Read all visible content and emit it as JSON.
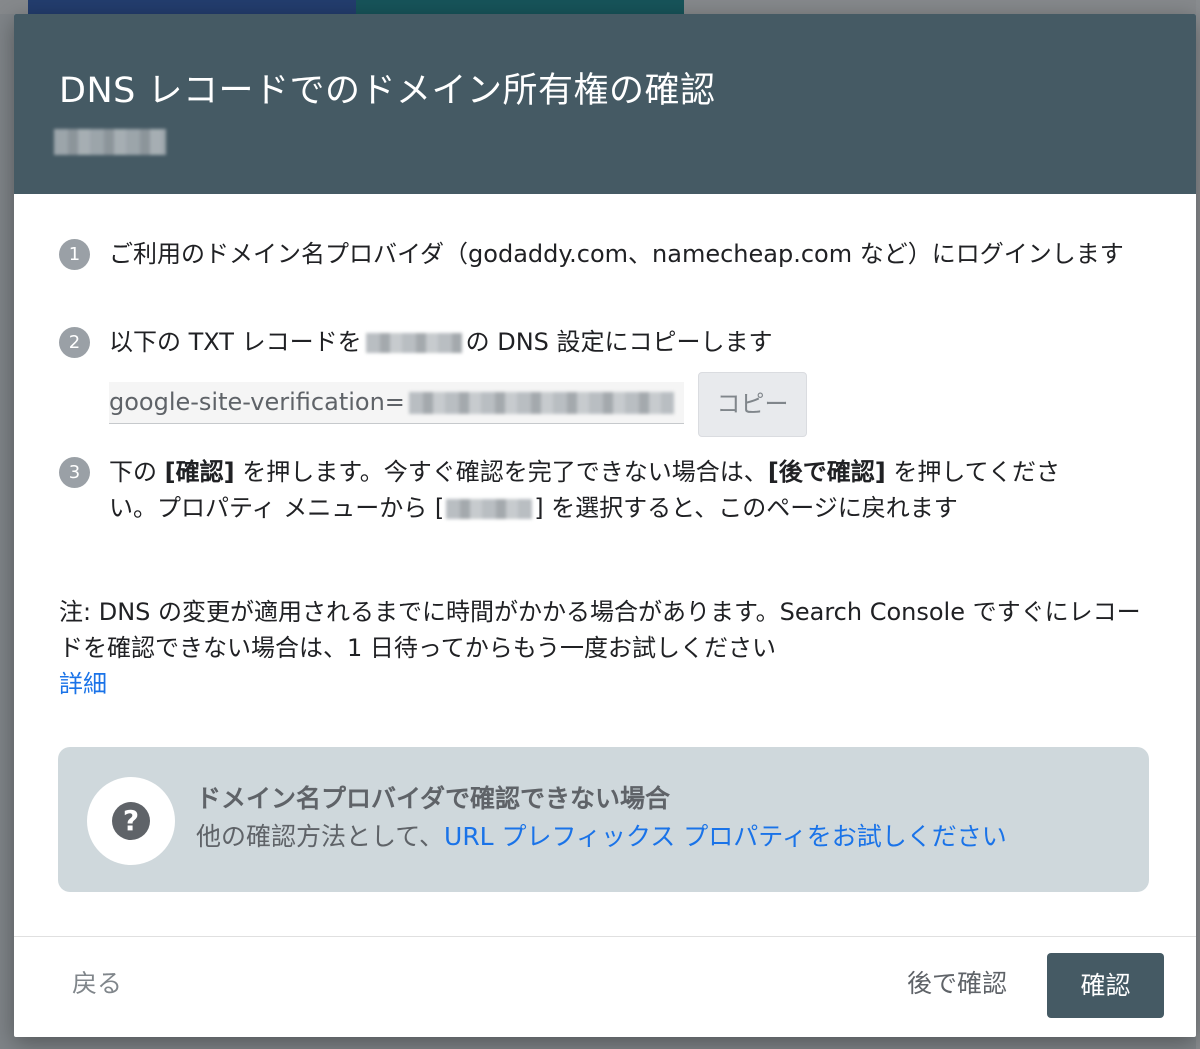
{
  "dialog": {
    "title": "DNS レコードでのドメイン所有権の確認",
    "steps": [
      {
        "number": "1",
        "text": "ご利用のドメイン名プロバイダ（godaddy.com、namecheap.com など）にログインします"
      },
      {
        "number": "2",
        "text_before": "以下の TXT レコードを",
        "text_after": "の DNS 設定にコピーします"
      },
      {
        "number": "3",
        "part1": "下の ",
        "bold1": "[確認]",
        "part2": " を押します。今すぐ確認を完了できない場合は、",
        "bold2": "[後で確認]",
        "part3": " を押してください。プロパティ メニューから [",
        "part4": "] を選択すると、このページに戻れます"
      }
    ],
    "txt_record": {
      "value": "google-site-verification="
    },
    "copy_label": "コピー",
    "note": "注: DNS の変更が適用されるまでに時間がかかる場合があります。Search Console ですぐにレコードを確認できない場合は、1 日待ってからもう一度お試しください",
    "detail_link": "詳細",
    "info": {
      "title": "ドメイン名プロバイダで確認できない場合",
      "desc_before": "他の確認方法として、",
      "desc_link": "URL プレフィックス プロパティをお試しください",
      "icon": "help-icon"
    },
    "footer": {
      "back": "戻る",
      "later": "後で確認",
      "confirm": "確認"
    }
  },
  "colors": {
    "header": "#455a64",
    "link": "#1a73e8",
    "info_bg": "#cfd8dc"
  }
}
